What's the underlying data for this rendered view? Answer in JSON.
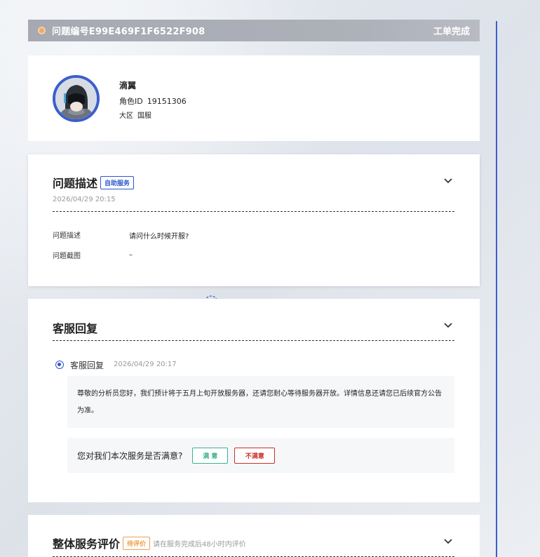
{
  "header": {
    "ticket_label": "问题编号E99E469F1F6522F908",
    "status": "工单完成"
  },
  "profile": {
    "name": "滴翼",
    "role_id_label": "角色ID",
    "role_id": "19151306",
    "region_label": "大区",
    "region": "国服"
  },
  "problem": {
    "title": "问题描述",
    "tag": "自助服务",
    "date": "2026/04/29 20:15",
    "desc_label": "问题描述",
    "desc_value": "请问什么时候开服?",
    "shot_label": "问题截图",
    "shot_value": "–"
  },
  "reply": {
    "title": "客服回复",
    "item_label": "客服回复",
    "item_date": "2026/04/29 20:17",
    "message": "尊敬的分析员您好，我们预计将于五月上旬开放服务器，还请您耐心等待服务器开放。详情信息还请您已后续官方公告为准。",
    "rating_question": "您对我们本次服务是否满意?",
    "btn_satisfied": "满 意",
    "btn_unsatisfied": "不满意"
  },
  "overall": {
    "title": "整体服务评价",
    "tag": "待评价",
    "hint": "请在服务完成后48小时内评价"
  },
  "colors": {
    "accent": "#2d57c9",
    "header_bg": "#aaadb5",
    "satisfied": "#3bb38e",
    "unsatisfied": "#c9302c",
    "pending": "#f0a052"
  }
}
